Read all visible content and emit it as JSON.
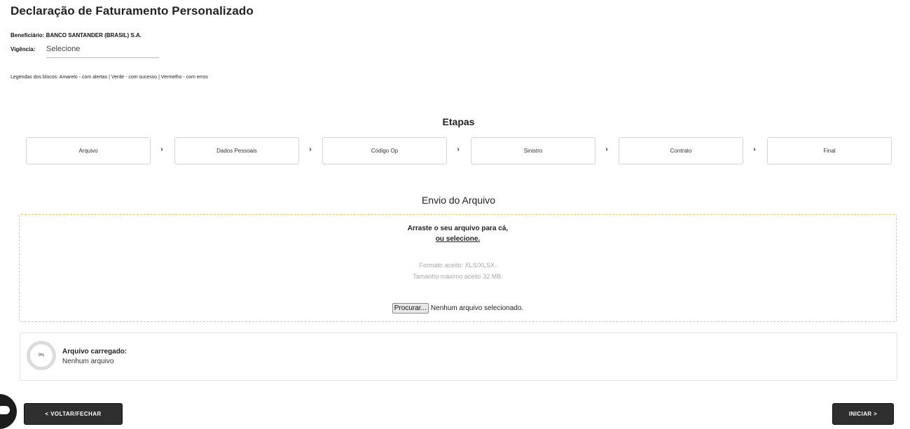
{
  "page": {
    "title": "Declaração de Faturamento Personalizado"
  },
  "beneficiario": {
    "text": "Beneficiário: BANCO SANTANDER (BRASIL) S.A."
  },
  "vigencia": {
    "label": "Vigência:",
    "selected": "Selecione"
  },
  "legend": {
    "text": "Legendas dos blocos: Amarelo - com alertas | Verde - com sucesso | Vermelho - com erros"
  },
  "steps": {
    "title": "Etapas",
    "items": [
      {
        "label": "Arquivo"
      },
      {
        "label": "Dados Pessoais"
      },
      {
        "label": "Código Op"
      },
      {
        "label": "Sinistro"
      },
      {
        "label": "Contrato"
      },
      {
        "label": "Final"
      }
    ],
    "separator": "›"
  },
  "upload": {
    "title": "Envio do Arquivo",
    "drag_text": "Arraste o seu arquivo para cá,",
    "select_link": "ou selecione.",
    "format_text": "Formato aceito: XLS/XLSX.",
    "size_text": "Tamanho máximo aceito 32 MB.",
    "browse_button": "Procurar...",
    "no_file_text": "Nenhum arquivo selecionado.",
    "border_color": "#e9c96a"
  },
  "status": {
    "progress": 0,
    "progress_label": "0%",
    "label": "Arquivo carregado:",
    "value": "Nenhum arquivo"
  },
  "actions": {
    "back_label": "< VOLTAR/FECHAR",
    "start_label": "INICIAR >"
  },
  "colors": {
    "button_bg": "#2f2f2f",
    "ring_track": "#dcdcdc"
  },
  "icons": {
    "chat": "chat-bubble-icon",
    "progress": "progress-ring-icon"
  }
}
